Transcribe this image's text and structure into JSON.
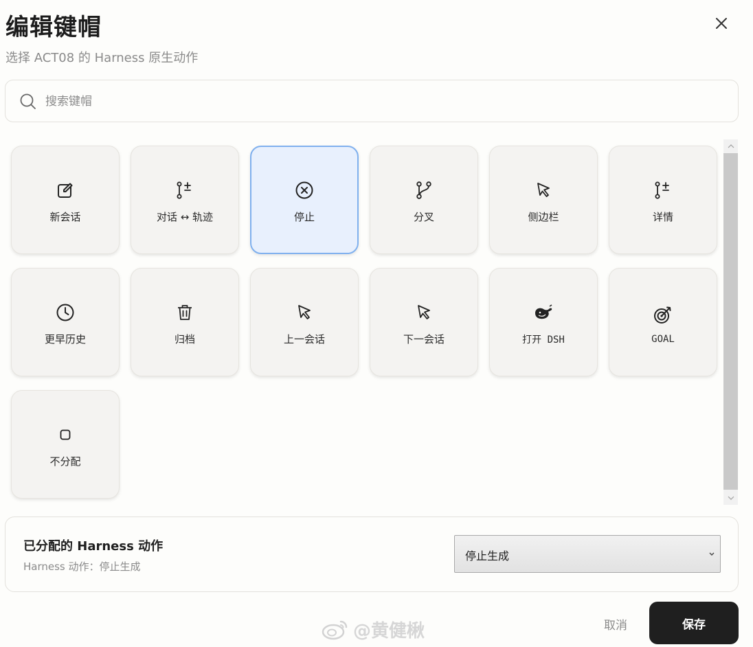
{
  "dialog": {
    "title": "编辑键帽",
    "subtitle": "选择 ACT08 的 Harness 原生动作"
  },
  "search": {
    "placeholder": "搜索键帽",
    "value": ""
  },
  "keycaps": [
    {
      "label": "新会话",
      "icon": "edit-icon",
      "selected": false
    },
    {
      "label": "对话 ↔ 轨迹",
      "icon": "list-plus-minus-icon",
      "selected": false
    },
    {
      "label": "停止",
      "icon": "stop-circle-icon",
      "selected": true
    },
    {
      "label": "分叉",
      "icon": "git-fork-icon",
      "selected": false
    },
    {
      "label": "侧边栏",
      "icon": "cursor-arrow-icon",
      "selected": false
    },
    {
      "label": "详情",
      "icon": "list-plus-minus-icon",
      "selected": false
    },
    {
      "label": "更早历史",
      "icon": "clock-icon",
      "selected": false
    },
    {
      "label": "归档",
      "icon": "trash-icon",
      "selected": false
    },
    {
      "label": "上一会话",
      "icon": "cursor-arrow-icon",
      "selected": false
    },
    {
      "label": "下一会话",
      "icon": "cursor-arrow-icon",
      "selected": false
    },
    {
      "label": "打开 DSH",
      "icon": "whale-icon",
      "selected": false
    },
    {
      "label": "GOAL",
      "icon": "target-arrow-icon",
      "selected": false
    },
    {
      "label": "不分配",
      "icon": "square-icon",
      "selected": false
    }
  ],
  "assigned": {
    "title": "已分配的 Harness 动作",
    "subtitle": "Harness 动作：停止生成",
    "select_value": "停止生成"
  },
  "footer": {
    "cancel_label": "取消",
    "save_label": "保存"
  },
  "watermark": {
    "text": "@黄健楸",
    "icon": "weibo-icon"
  },
  "colors": {
    "selected_border": "#7fb0ee",
    "selected_bg": "#e8f0fd",
    "save_bg": "#1f1f1f"
  }
}
